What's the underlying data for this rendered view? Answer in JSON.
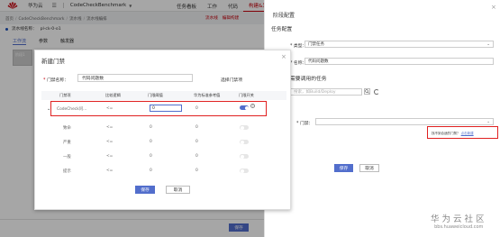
{
  "colors": {
    "accent": "#526ecc",
    "brand": "#c7000b",
    "highlight_frame": "#e02020"
  },
  "topbar": {
    "brand": "华为云",
    "project": "CodeCheckBenchmark",
    "nav": [
      "任务看板",
      "工作",
      "代码",
      "构建&发布"
    ],
    "nav_active_index": 3
  },
  "breadcrumb": [
    "首页",
    "CodeCheckBenchmark",
    "流水线",
    "流水线编排"
  ],
  "breadcrumb_right": {
    "a": "流水线",
    "b": "编辑构建"
  },
  "pipeline": {
    "name_label": "流水线名称：",
    "name_value": "pl-ck-0-o1",
    "tabs": [
      "工作流",
      "参数",
      "触发器"
    ],
    "stage_label": "阶段1"
  },
  "left_save": "保存",
  "modal": {
    "title": "新建门禁",
    "name_label": "门禁名称：",
    "name_value": "代码问题数",
    "select_label": "选择门禁项",
    "columns": [
      "门禁项",
      "比较逻辑",
      "门限阈值",
      "华为标准参考值",
      "门限开关"
    ],
    "rows": [
      {
        "item": "CodeCheck问...",
        "logic": "<=",
        "threshold": "0",
        "reference": "0",
        "on": true
      },
      {
        "item": "致命",
        "logic": "<=",
        "threshold": "0",
        "reference": "0",
        "on": false
      },
      {
        "item": "严重",
        "logic": "<=",
        "threshold": "0",
        "reference": "0",
        "on": false
      },
      {
        "item": "一般",
        "logic": "<=",
        "threshold": "0",
        "reference": "0",
        "on": false
      },
      {
        "item": "提示",
        "logic": "<=",
        "threshold": "0",
        "reference": "0",
        "on": false
      }
    ],
    "help": "?",
    "save": "保存",
    "cancel": "取消"
  },
  "right": {
    "title": "阶段配置",
    "section_task": "任务配置",
    "type_label": "* 类型：",
    "type_value": "门禁任务",
    "name_label": "* 名称：",
    "name_value": "代码问题数",
    "section_deps": "需要调用的任务",
    "search_placeholder": "搜索，如Build/Deploy",
    "gate_label": "* 门禁：",
    "gate_hint": "找不到合适的门禁？",
    "gate_link": "点击新建",
    "save": "保存",
    "cancel": "取消"
  },
  "watermark": {
    "cn": "华为云社区",
    "url": "bbs.huaweicloud.com"
  },
  "icons": [
    "huawei-logo-icon",
    "chevron-down-icon",
    "close-icon",
    "search-icon",
    "refresh-icon",
    "help-icon",
    "expand-icon"
  ]
}
